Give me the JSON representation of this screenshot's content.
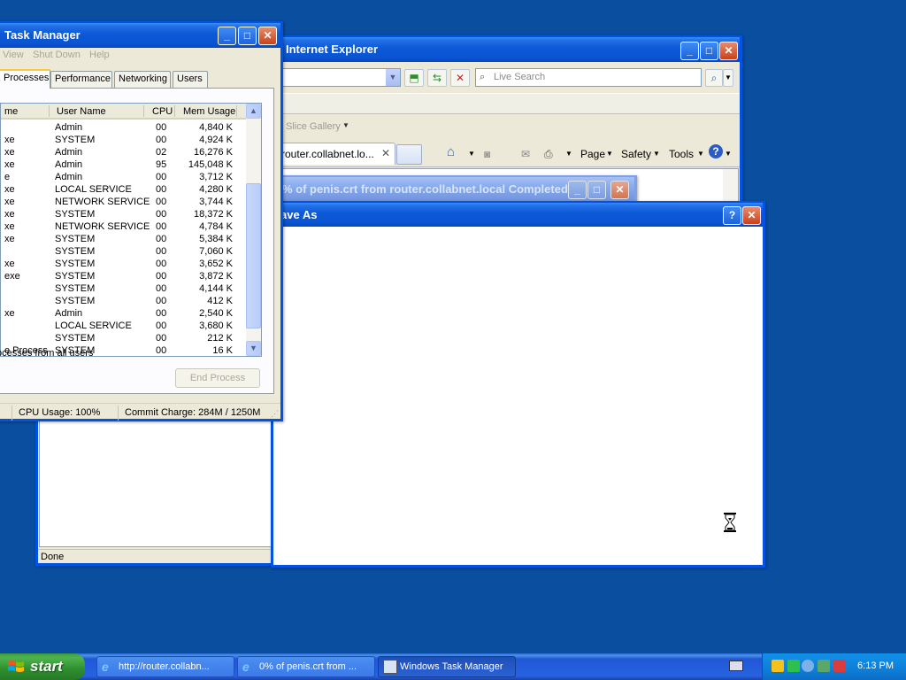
{
  "colors": {
    "desktop": "#0A4EA0",
    "titlebar": "#0A55D4",
    "taskbar": "#245EDC",
    "start_green": "#3C9A3C"
  },
  "ie": {
    "title": "Internet Explorer",
    "search_placeholder": "Live Search",
    "slice_gallery": "Slice Gallery",
    "tab_label": "router.collabnet.lo...",
    "cmd": {
      "page": "Page",
      "safety": "Safety",
      "tools": "Tools"
    },
    "status": "Done"
  },
  "download": {
    "title": "% of penis.crt from router.collabnet.local Completed"
  },
  "saveas": {
    "title": "ave As",
    "help_icon": "help-icon",
    "close_icon": "close-icon"
  },
  "taskmgr": {
    "title": "Task Manager",
    "menu": [
      "View",
      "Shut Down",
      "Help"
    ],
    "tabs": [
      "Processes",
      "Performance",
      "Networking",
      "Users"
    ],
    "columns": [
      "me",
      "User Name",
      "CPU",
      "Mem Usage"
    ],
    "processes": [
      {
        "name": "",
        "user": "Admin",
        "cpu": "00",
        "mem": "4,840 K"
      },
      {
        "name": "xe",
        "user": "SYSTEM",
        "cpu": "00",
        "mem": "4,924 K"
      },
      {
        "name": "xe",
        "user": "Admin",
        "cpu": "02",
        "mem": "16,276 K"
      },
      {
        "name": "xe",
        "user": "Admin",
        "cpu": "95",
        "mem": "145,048 K"
      },
      {
        "name": "e",
        "user": "Admin",
        "cpu": "00",
        "mem": "3,712 K"
      },
      {
        "name": "xe",
        "user": "LOCAL SERVICE",
        "cpu": "00",
        "mem": "4,280 K"
      },
      {
        "name": "xe",
        "user": "NETWORK SERVICE",
        "cpu": "00",
        "mem": "3,744 K"
      },
      {
        "name": "xe",
        "user": "SYSTEM",
        "cpu": "00",
        "mem": "18,372 K"
      },
      {
        "name": "xe",
        "user": "NETWORK SERVICE",
        "cpu": "00",
        "mem": "4,784 K"
      },
      {
        "name": "xe",
        "user": "SYSTEM",
        "cpu": "00",
        "mem": "5,384 K"
      },
      {
        "name": "",
        "user": "SYSTEM",
        "cpu": "00",
        "mem": "7,060 K"
      },
      {
        "name": "xe",
        "user": "SYSTEM",
        "cpu": "00",
        "mem": "3,652 K"
      },
      {
        "name": "exe",
        "user": "SYSTEM",
        "cpu": "00",
        "mem": "3,872 K"
      },
      {
        "name": "",
        "user": "SYSTEM",
        "cpu": "00",
        "mem": "4,144 K"
      },
      {
        "name": "",
        "user": "SYSTEM",
        "cpu": "00",
        "mem": "412 K"
      },
      {
        "name": "xe",
        "user": "Admin",
        "cpu": "00",
        "mem": "2,540 K"
      },
      {
        "name": "",
        "user": "LOCAL SERVICE",
        "cpu": "00",
        "mem": "3,680 K"
      },
      {
        "name": "",
        "user": "SYSTEM",
        "cpu": "00",
        "mem": "212 K"
      },
      {
        "name": "e Process",
        "user": "SYSTEM",
        "cpu": "00",
        "mem": "16 K"
      }
    ],
    "show_all": "ocesses from all users",
    "end_process": "End Process",
    "status_cpu": "CPU Usage: 100%",
    "status_commit": "Commit Charge: 284M / 1250M"
  },
  "taskbar": {
    "start": "start",
    "tasks": [
      {
        "label": "http://router.collabn...",
        "icon": "ie-icon"
      },
      {
        "label": "0% of penis.crt from ...",
        "icon": "ie-icon"
      },
      {
        "label": "Windows Task Manager",
        "icon": "taskmgr-icon"
      }
    ],
    "clock": "6:13 PM"
  }
}
